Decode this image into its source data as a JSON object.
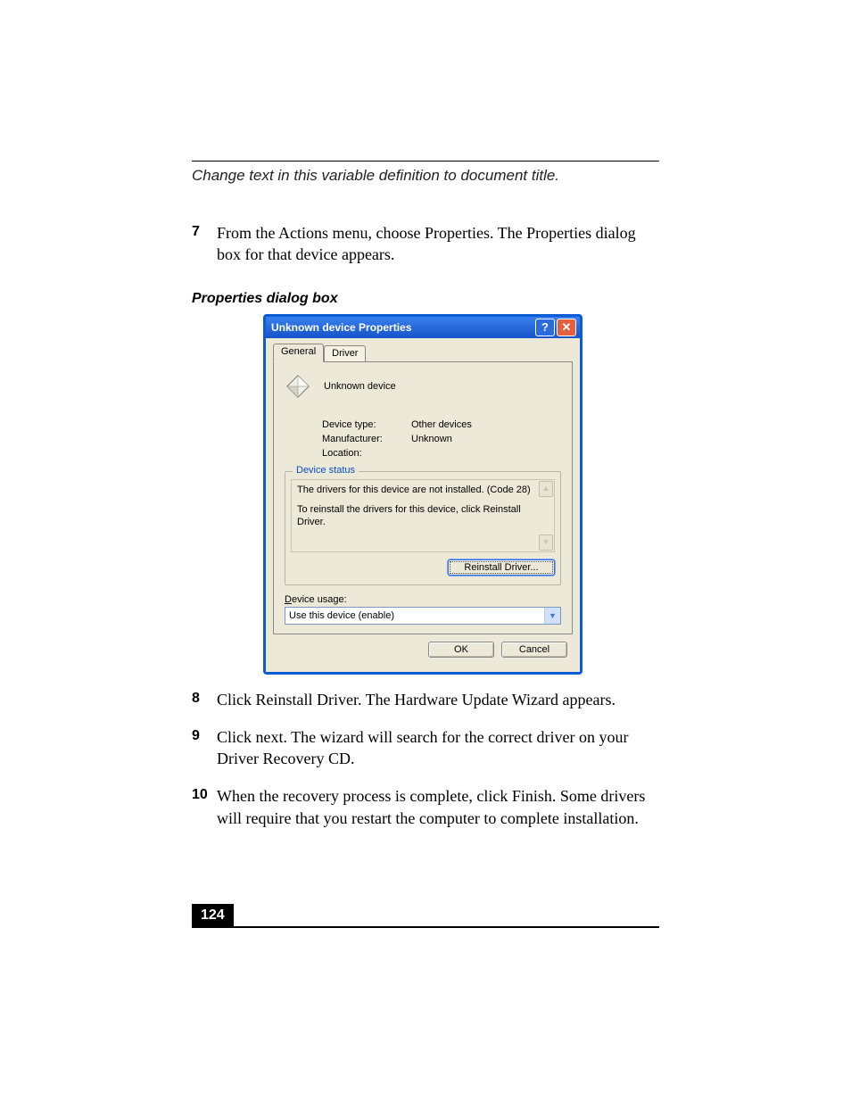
{
  "header_text": "Change text in this variable definition to document title.",
  "steps_a": [
    {
      "num": "7",
      "text": "From the Actions menu, choose Properties. The Properties dialog box for that device appears."
    }
  ],
  "caption": "Properties dialog box",
  "dialog": {
    "title": "Unknown device Properties",
    "help_glyph": "?",
    "close_glyph": "✕",
    "tabs": {
      "general": "General",
      "driver": "Driver"
    },
    "device_name": "Unknown device",
    "info": {
      "device_type_label": "Device type:",
      "device_type_value": "Other devices",
      "manufacturer_label": "Manufacturer:",
      "manufacturer_value": "Unknown",
      "location_label": "Location:"
    },
    "status": {
      "legend": "Device status",
      "line1": "The drivers for this device are not installed. (Code 28)",
      "line2": "To reinstall the drivers for this device, click Reinstall Driver."
    },
    "reinstall_label": "Reinstall Driver...",
    "usage_label_pre": "D",
    "usage_label_post": "evice usage:",
    "usage_value": "Use this device (enable)",
    "ok_label": "OK",
    "cancel_label": "Cancel"
  },
  "steps_b": [
    {
      "num": "8",
      "text": "Click Reinstall Driver. The Hardware Update Wizard appears."
    },
    {
      "num": "9",
      "text": "Click next. The wizard will search for the correct driver on your Driver Recovery CD."
    },
    {
      "num": "10",
      "text": "When the recovery process is complete, click Finish. Some drivers will require that you restart the computer to complete installation."
    }
  ],
  "page_number": "124"
}
